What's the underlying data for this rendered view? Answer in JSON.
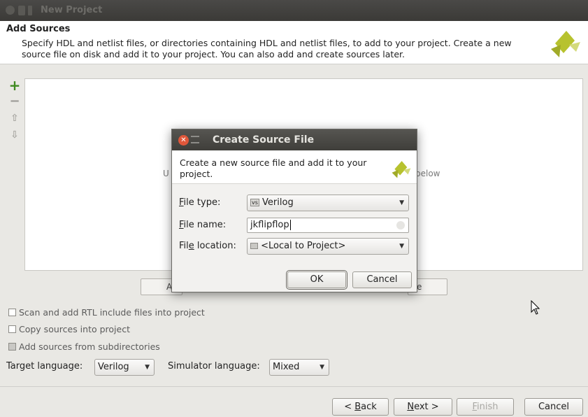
{
  "window": {
    "title": "New Project",
    "header_title": "Add Sources",
    "header_description": "Specify HDL and netlist files, or directories containing HDL and netlist files, to add to your project. Create a new source file on disk and add it to your project. You can also add and create sources later."
  },
  "sources_panel": {
    "hint_left": "U",
    "hint_right": "below",
    "side_buttons": {
      "add": "+",
      "remove": "−",
      "up": "⇧",
      "down": "⇩"
    },
    "button_left_partial": "A",
    "button_right_partial": "e"
  },
  "options": [
    {
      "label": "Scan and add RTL include files into project",
      "checked": false
    },
    {
      "label": "Copy sources into project",
      "checked": false
    },
    {
      "label": "Add sources from subdirectories",
      "checked": true
    }
  ],
  "target_language": {
    "label": "Target language:",
    "value": "Verilog"
  },
  "simulator_language": {
    "label": "Simulator language:",
    "value": "Mixed"
  },
  "footer_buttons": {
    "back_lead": "< ",
    "back_u": "B",
    "back_rest": "ack",
    "next_u": "N",
    "next_rest": "ext >",
    "finish_u": "F",
    "finish_rest": "inish",
    "cancel": "Cancel"
  },
  "dialog": {
    "title": "Create Source File",
    "description": "Create a new source file and add it to your project.",
    "file_type_label_u": "F",
    "file_type_label_rest": "ile type:",
    "file_type_value": "Verilog",
    "file_type_badge": "vs",
    "file_name_label_u": "F",
    "file_name_label_rest": "ile name:",
    "file_name_value": "jkflipflop",
    "file_location_label_pre": "Fil",
    "file_location_label_u": "e",
    "file_location_label_rest": " location:",
    "file_location_value": "<Local to Project>",
    "ok": "OK",
    "cancel": "Cancel"
  },
  "colors": {
    "logo_green": "#b7c22e",
    "close_red": "#e0573a",
    "add_green": "#3f8a1f"
  }
}
